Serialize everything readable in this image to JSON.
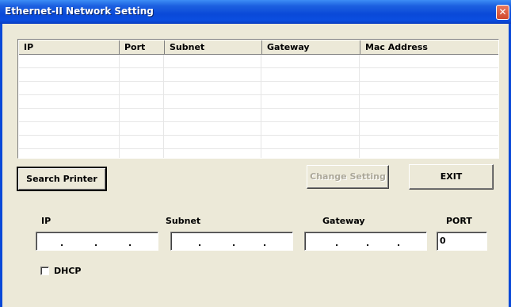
{
  "window": {
    "title": "Ethernet-II Network Setting",
    "close_glyph": "✕"
  },
  "table": {
    "columns": [
      "IP",
      "Port",
      "Subnet",
      "Gateway",
      "Mac Address"
    ],
    "rows": []
  },
  "buttons": {
    "search": "Search Printer",
    "change": "Change Setting",
    "exit": "EXIT"
  },
  "fields": {
    "ip_label": "IP",
    "subnet_label": "Subnet",
    "gateway_label": "Gateway",
    "port_label": "PORT",
    "port_value": "0",
    "ip_dots": ".",
    "dhcp_label": "DHCP",
    "dhcp_checked": false
  },
  "icons": {
    "close": "close-icon"
  }
}
